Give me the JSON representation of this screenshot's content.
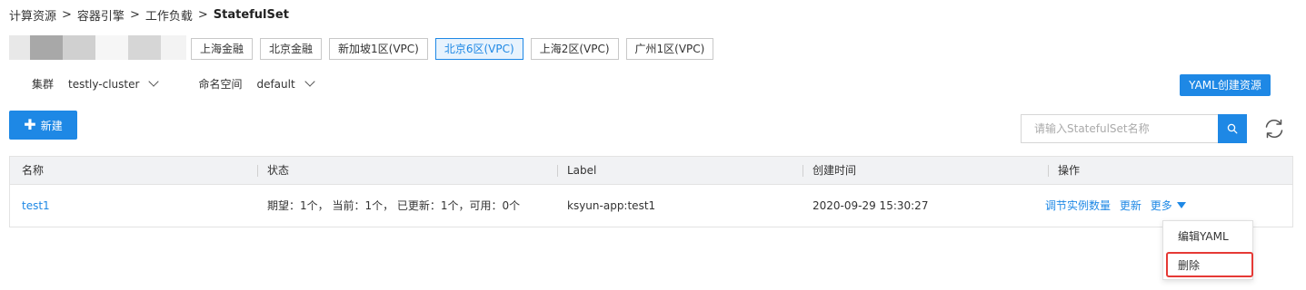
{
  "breadcrumb": {
    "items": [
      "计算资源",
      "容器引擎",
      "工作负载"
    ],
    "separator": ">",
    "current": "StatefulSet"
  },
  "regions": {
    "items": [
      "上海金融",
      "北京金融",
      "新加坡1区(VPC)",
      "北京6区(VPC)",
      "上海2区(VPC)",
      "广州1区(VPC)"
    ],
    "active": "北京6区(VPC)"
  },
  "filters": {
    "cluster_label": "集群",
    "cluster_value": "testly-cluster",
    "namespace_label": "命名空间",
    "namespace_value": "default"
  },
  "toolbar": {
    "yaml_create_label": "YAML创建资源",
    "new_label": "新建",
    "new_icon": "plus-icon",
    "search_placeholder": "请输入StatefulSet名称",
    "search_icon": "search-icon",
    "refresh_icon": "refresh-icon"
  },
  "table": {
    "columns": [
      "名称",
      "状态",
      "Label",
      "创建时间",
      "操作"
    ],
    "rows": [
      {
        "name": "test1",
        "status": "期望：1个， 当前：1个， 已更新：1个，可用：0个",
        "label": "ksyun-app:test1",
        "created": "2020-09-29 15:30:27",
        "actions": {
          "scale": "调节实例数量",
          "update": "更新",
          "more": "更多"
        }
      }
    ]
  },
  "more_menu": {
    "items": [
      "编辑YAML",
      "删除"
    ],
    "highlighted": "删除"
  },
  "colors": {
    "primary": "#1e88e5",
    "header_bg": "#f1f2f4",
    "highlight_border": "#e53935"
  }
}
